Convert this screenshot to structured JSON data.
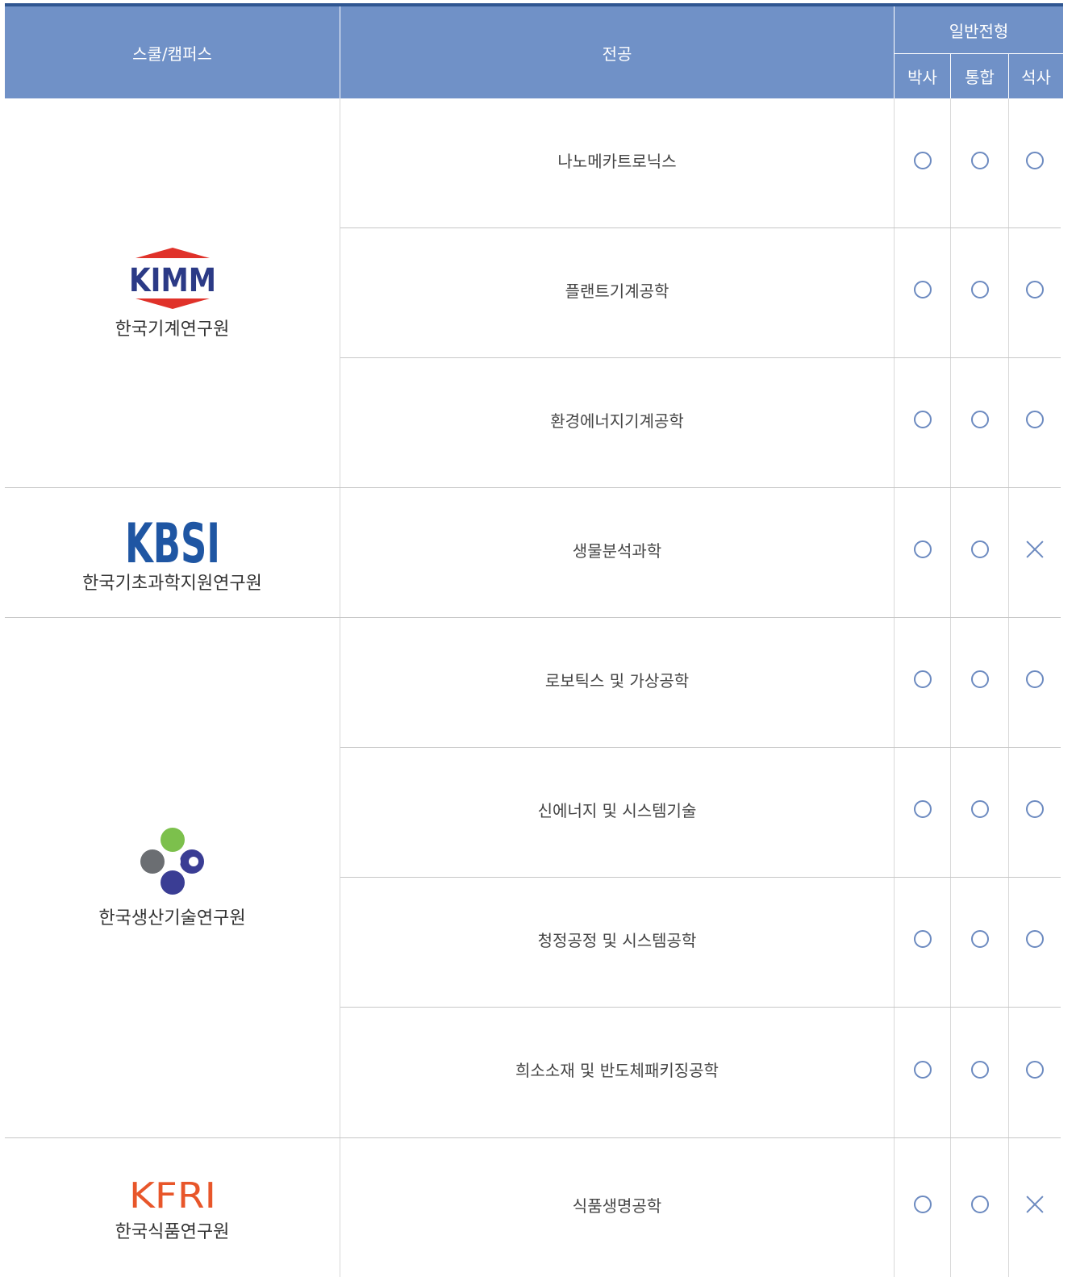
{
  "header": {
    "school_label": "스쿨/캠퍼스",
    "major_label": "전공",
    "group_label": "일반전형",
    "sub": [
      "박사",
      "통합",
      "석사"
    ]
  },
  "mark_symbols": {
    "yes": "○",
    "no": "×"
  },
  "schools": [
    {
      "logo_text": "KIMM",
      "name": "한국기계연구원"
    },
    {
      "logo_text": "KBSI",
      "name": "한국기초과학지원연구원"
    },
    {
      "logo_text": "",
      "name": "한국생산기술연구원"
    },
    {
      "logo_text": "KFRI",
      "name": "한국식품연구원"
    }
  ],
  "rows": [
    {
      "major": "나노메카트로닉스",
      "marks": [
        "o",
        "o",
        "o"
      ]
    },
    {
      "major": "플랜트기계공학",
      "marks": [
        "o",
        "o",
        "o"
      ]
    },
    {
      "major": "환경에너지기계공학",
      "marks": [
        "o",
        "o",
        "o"
      ]
    },
    {
      "major": "생물분석과학",
      "marks": [
        "o",
        "o",
        "x"
      ]
    },
    {
      "major": "로보틱스 및 가상공학",
      "marks": [
        "o",
        "o",
        "o"
      ]
    },
    {
      "major": "신에너지 및 시스템기술",
      "marks": [
        "o",
        "o",
        "o"
      ]
    },
    {
      "major": "청정공정 및 시스템공학",
      "marks": [
        "o",
        "o",
        "o"
      ]
    },
    {
      "major": "희소소재 및 반도체패키징공학",
      "marks": [
        "o",
        "o",
        "o"
      ]
    },
    {
      "major": "식품생명공학",
      "marks": [
        "o",
        "o",
        "x"
      ]
    }
  ],
  "colors": {
    "header_bg": "#7091c7",
    "top_bar": "#2f5691",
    "mark": "#6c8ac0",
    "kimm_red": "#e0322a",
    "kimm_blue": "#2b3a86",
    "kbsi_blue": "#1f56a3",
    "kfri_orange": "#e8562a"
  }
}
